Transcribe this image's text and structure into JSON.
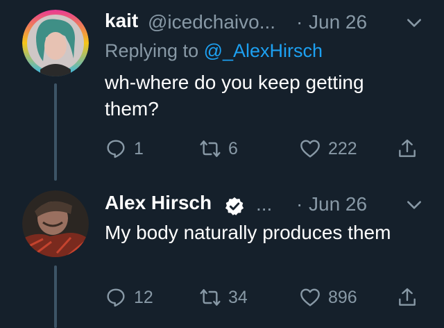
{
  "colors": {
    "background": "#15202b",
    "secondary_text": "#8899a6",
    "link": "#1da1f2",
    "thread_line": "#3d5466"
  },
  "tweets": [
    {
      "name": "kait",
      "handle": "@icedchaivo...",
      "separator": "·",
      "date": "Jun 26",
      "replying_prefix": "Replying to",
      "replying_to": "@_AlexHirsch",
      "text": "wh-where do you keep getting them?",
      "replies": "1",
      "retweets": "6",
      "likes": "222"
    },
    {
      "name": "Alex Hirsch",
      "verified": true,
      "more": "...",
      "separator": "·",
      "date": "Jun 26",
      "text": "My body naturally produces them",
      "replies": "12",
      "retweets": "34",
      "likes": "896"
    }
  ],
  "icons": [
    "chevron-down-icon",
    "verified-badge-icon",
    "reply-icon",
    "retweet-icon",
    "like-icon",
    "share-icon"
  ]
}
